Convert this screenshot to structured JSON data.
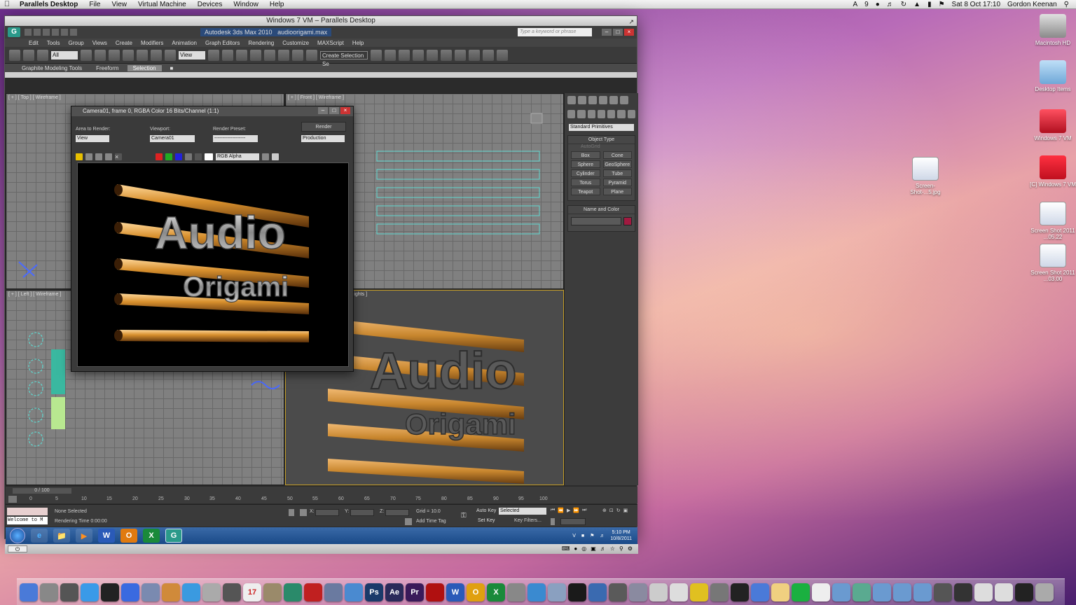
{
  "menubar": {
    "app": "Parallels Desktop",
    "items": [
      "File",
      "View",
      "Virtual Machine",
      "Devices",
      "Window",
      "Help"
    ],
    "clock": "Sat 8 Oct  17:10",
    "user": "Gordon Keenan",
    "badge": "9"
  },
  "parallels": {
    "window_title": "Windows 7 VM – Parallels Desktop"
  },
  "max": {
    "app_title": "Autodesk 3ds Max 2010",
    "file": "audioorigami.max",
    "search_placeholder": "Type a keyword or phrase",
    "menu": [
      "Edit",
      "Tools",
      "Group",
      "Views",
      "Create",
      "Modifiers",
      "Animation",
      "Graph Editors",
      "Rendering",
      "Customize",
      "MAXScript",
      "Help"
    ],
    "toolbar": {
      "filter": "All",
      "ref_coord": "View",
      "selection_set": "Create Selection Se"
    },
    "ribbon": [
      "Graphite Modeling Tools",
      "Freeform",
      "Selection"
    ],
    "viewports": {
      "top": "[ + ] [ Top ] [ Wireframe ]",
      "front": "[ + ] [ Front ] [ Wireframe ]",
      "left": "[ + ] [ Left ] [ Wireframe ]",
      "persp": "ghlights ]"
    },
    "command_panel": {
      "category": "Standard Primitives",
      "object_type": "Object Type",
      "autogrid": "AutoGrid",
      "buttons": [
        "Box",
        "Cone",
        "Sphere",
        "GeoSphere",
        "Cylinder",
        "Tube",
        "Torus",
        "Pyramid",
        "Teapot",
        "Plane"
      ],
      "name_and_color": "Name and Color"
    },
    "render_window": {
      "title": "Camera01, frame 0, RGBA Color 16 Bits/Channel (1:1)",
      "area_label": "Area to Render:",
      "area_value": "View",
      "viewport_label": "Viewport:",
      "viewport_value": "Camera01",
      "preset_label": "Render Preset:",
      "preset_value": "-------------------",
      "render_button": "Render",
      "production": "Production",
      "channel": "RGB Alpha"
    },
    "render_text": {
      "line1": "Audio",
      "line2": "Origami"
    },
    "timeline": {
      "frame": "0 / 100",
      "ticks": [
        "0",
        "5",
        "10",
        "15",
        "20",
        "25",
        "30",
        "35",
        "40",
        "45",
        "50",
        "55",
        "60",
        "65",
        "70",
        "75",
        "80",
        "85",
        "90",
        "95",
        "100"
      ]
    },
    "status": {
      "listener": "Welcome to M",
      "none_selected": "None Selected",
      "render_time": "Rendering Time  0:00:00",
      "x": "X:",
      "y": "Y:",
      "z": "Z:",
      "grid": "Grid = 10.0",
      "add_time_tag": "Add Time Tag",
      "auto_key": "Auto Key",
      "set_key": "Set Key",
      "selected": "Selected",
      "key_filters": "Key Filters..."
    }
  },
  "taskbar": {
    "time": "5:10 PM",
    "date": "10/8/2011",
    "apps": [
      "e",
      "📁",
      "▶",
      "W",
      "O",
      "X",
      "G"
    ]
  },
  "desktop_icons": [
    {
      "label": "Macintosh HD"
    },
    {
      "label": "Desktop Items"
    },
    {
      "label": "Windows 7 VM"
    },
    {
      "label": "Screen-Shot-...5.jpg"
    },
    {
      "label": "[C] Windows 7 VM"
    },
    {
      "label": "Screen Shot 2011 ...05.22"
    },
    {
      "label": "Screen Shot 2011 ...03.00"
    }
  ],
  "colors": {
    "gold": "#c8862e",
    "viewport_grid": "#808080",
    "selection_cyan": "#5fd8d0",
    "taskbar": "#1a4a88"
  }
}
